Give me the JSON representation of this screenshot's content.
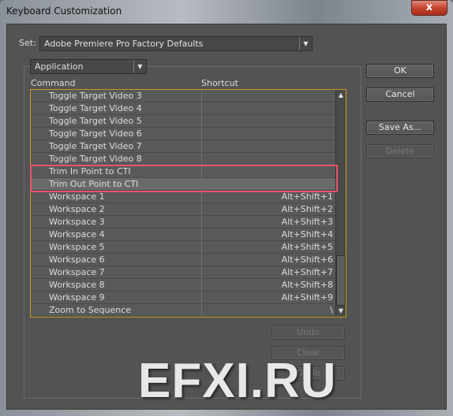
{
  "window": {
    "title": "Keyboard Customization",
    "close_label": "x"
  },
  "set": {
    "label": "Set:",
    "value": "Adobe Premiere Pro Factory Defaults"
  },
  "category": {
    "value": "Application"
  },
  "columns": {
    "command": "Command",
    "shortcut": "Shortcut"
  },
  "rows": [
    {
      "command": "Toggle Target Video 3",
      "shortcut": ""
    },
    {
      "command": "Toggle Target Video 4",
      "shortcut": ""
    },
    {
      "command": "Toggle Target Video 5",
      "shortcut": ""
    },
    {
      "command": "Toggle Target Video 6",
      "shortcut": ""
    },
    {
      "command": "Toggle Target Video 7",
      "shortcut": ""
    },
    {
      "command": "Toggle Target Video 8",
      "shortcut": ""
    },
    {
      "command": "Trim In Point to CTI",
      "shortcut": ""
    },
    {
      "command": "Trim Out Point to CTI",
      "shortcut": "",
      "selected": true
    },
    {
      "command": "Workspace 1",
      "shortcut": "Alt+Shift+1"
    },
    {
      "command": "Workspace 2",
      "shortcut": "Alt+Shift+2"
    },
    {
      "command": "Workspace 3",
      "shortcut": "Alt+Shift+3"
    },
    {
      "command": "Workspace 4",
      "shortcut": "Alt+Shift+4"
    },
    {
      "command": "Workspace 5",
      "shortcut": "Alt+Shift+5"
    },
    {
      "command": "Workspace 6",
      "shortcut": "Alt+Shift+6"
    },
    {
      "command": "Workspace 7",
      "shortcut": "Alt+Shift+7"
    },
    {
      "command": "Workspace 8",
      "shortcut": "Alt+Shift+8"
    },
    {
      "command": "Workspace 9",
      "shortcut": "Alt+Shift+9"
    },
    {
      "command": "Zoom to Sequence",
      "shortcut": "\\"
    }
  ],
  "buttons": {
    "ok": "OK",
    "cancel": "Cancel",
    "save_as": "Save As...",
    "delete": "Delete",
    "undo": "Undo",
    "clear": "Clear",
    "go_to": "Go To"
  },
  "highlight_color": "#e8566a",
  "watermark": "EFXI.RU"
}
